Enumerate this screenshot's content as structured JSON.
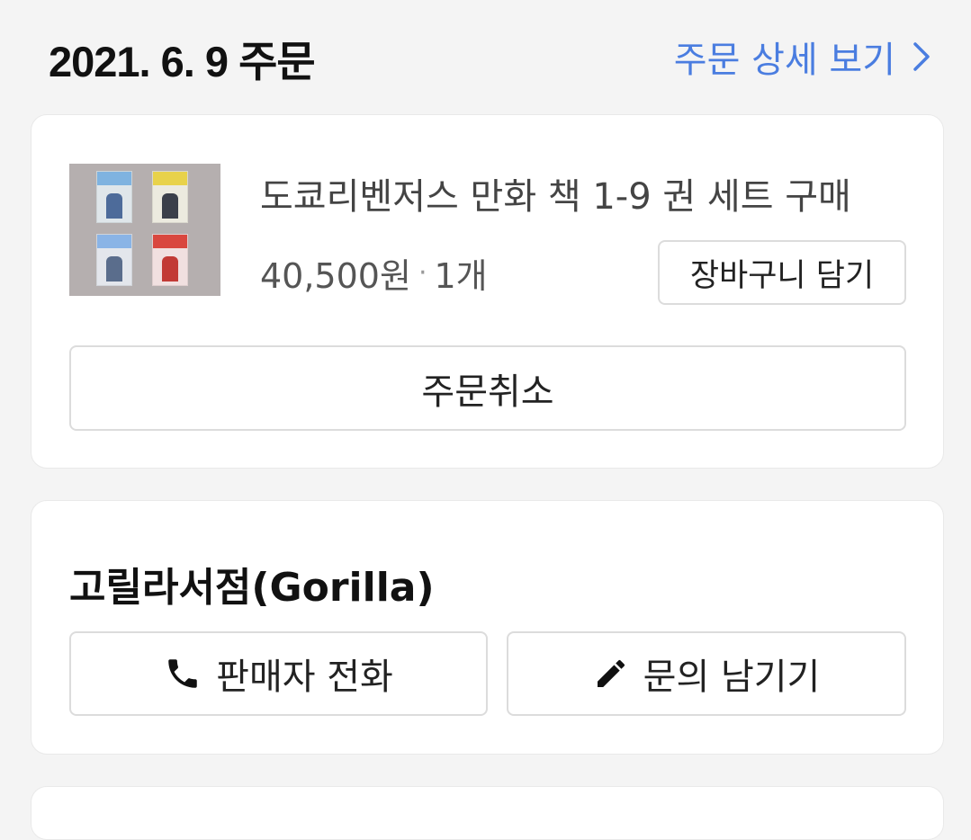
{
  "header": {
    "order_date": "2021. 6. 9 주문",
    "detail_link": "주문 상세 보기"
  },
  "order": {
    "product_title": "도쿄리벤저스 만화 책 1-9 권 세트 구매",
    "price": "40,500원",
    "separator": "·",
    "quantity": "1개",
    "cart_button": "장바구니 담기",
    "cancel_button": "주문취소"
  },
  "seller": {
    "name": "고릴라서점(Gorilla)",
    "call_button": "판매자 전화",
    "inquiry_button": "문의 남기기"
  },
  "icons": {
    "chevron": "chevron-right-icon",
    "phone": "phone-icon",
    "pencil": "pencil-icon"
  },
  "colors": {
    "accent": "#4a7de0",
    "background": "#f4f4f4",
    "card": "#ffffff"
  }
}
